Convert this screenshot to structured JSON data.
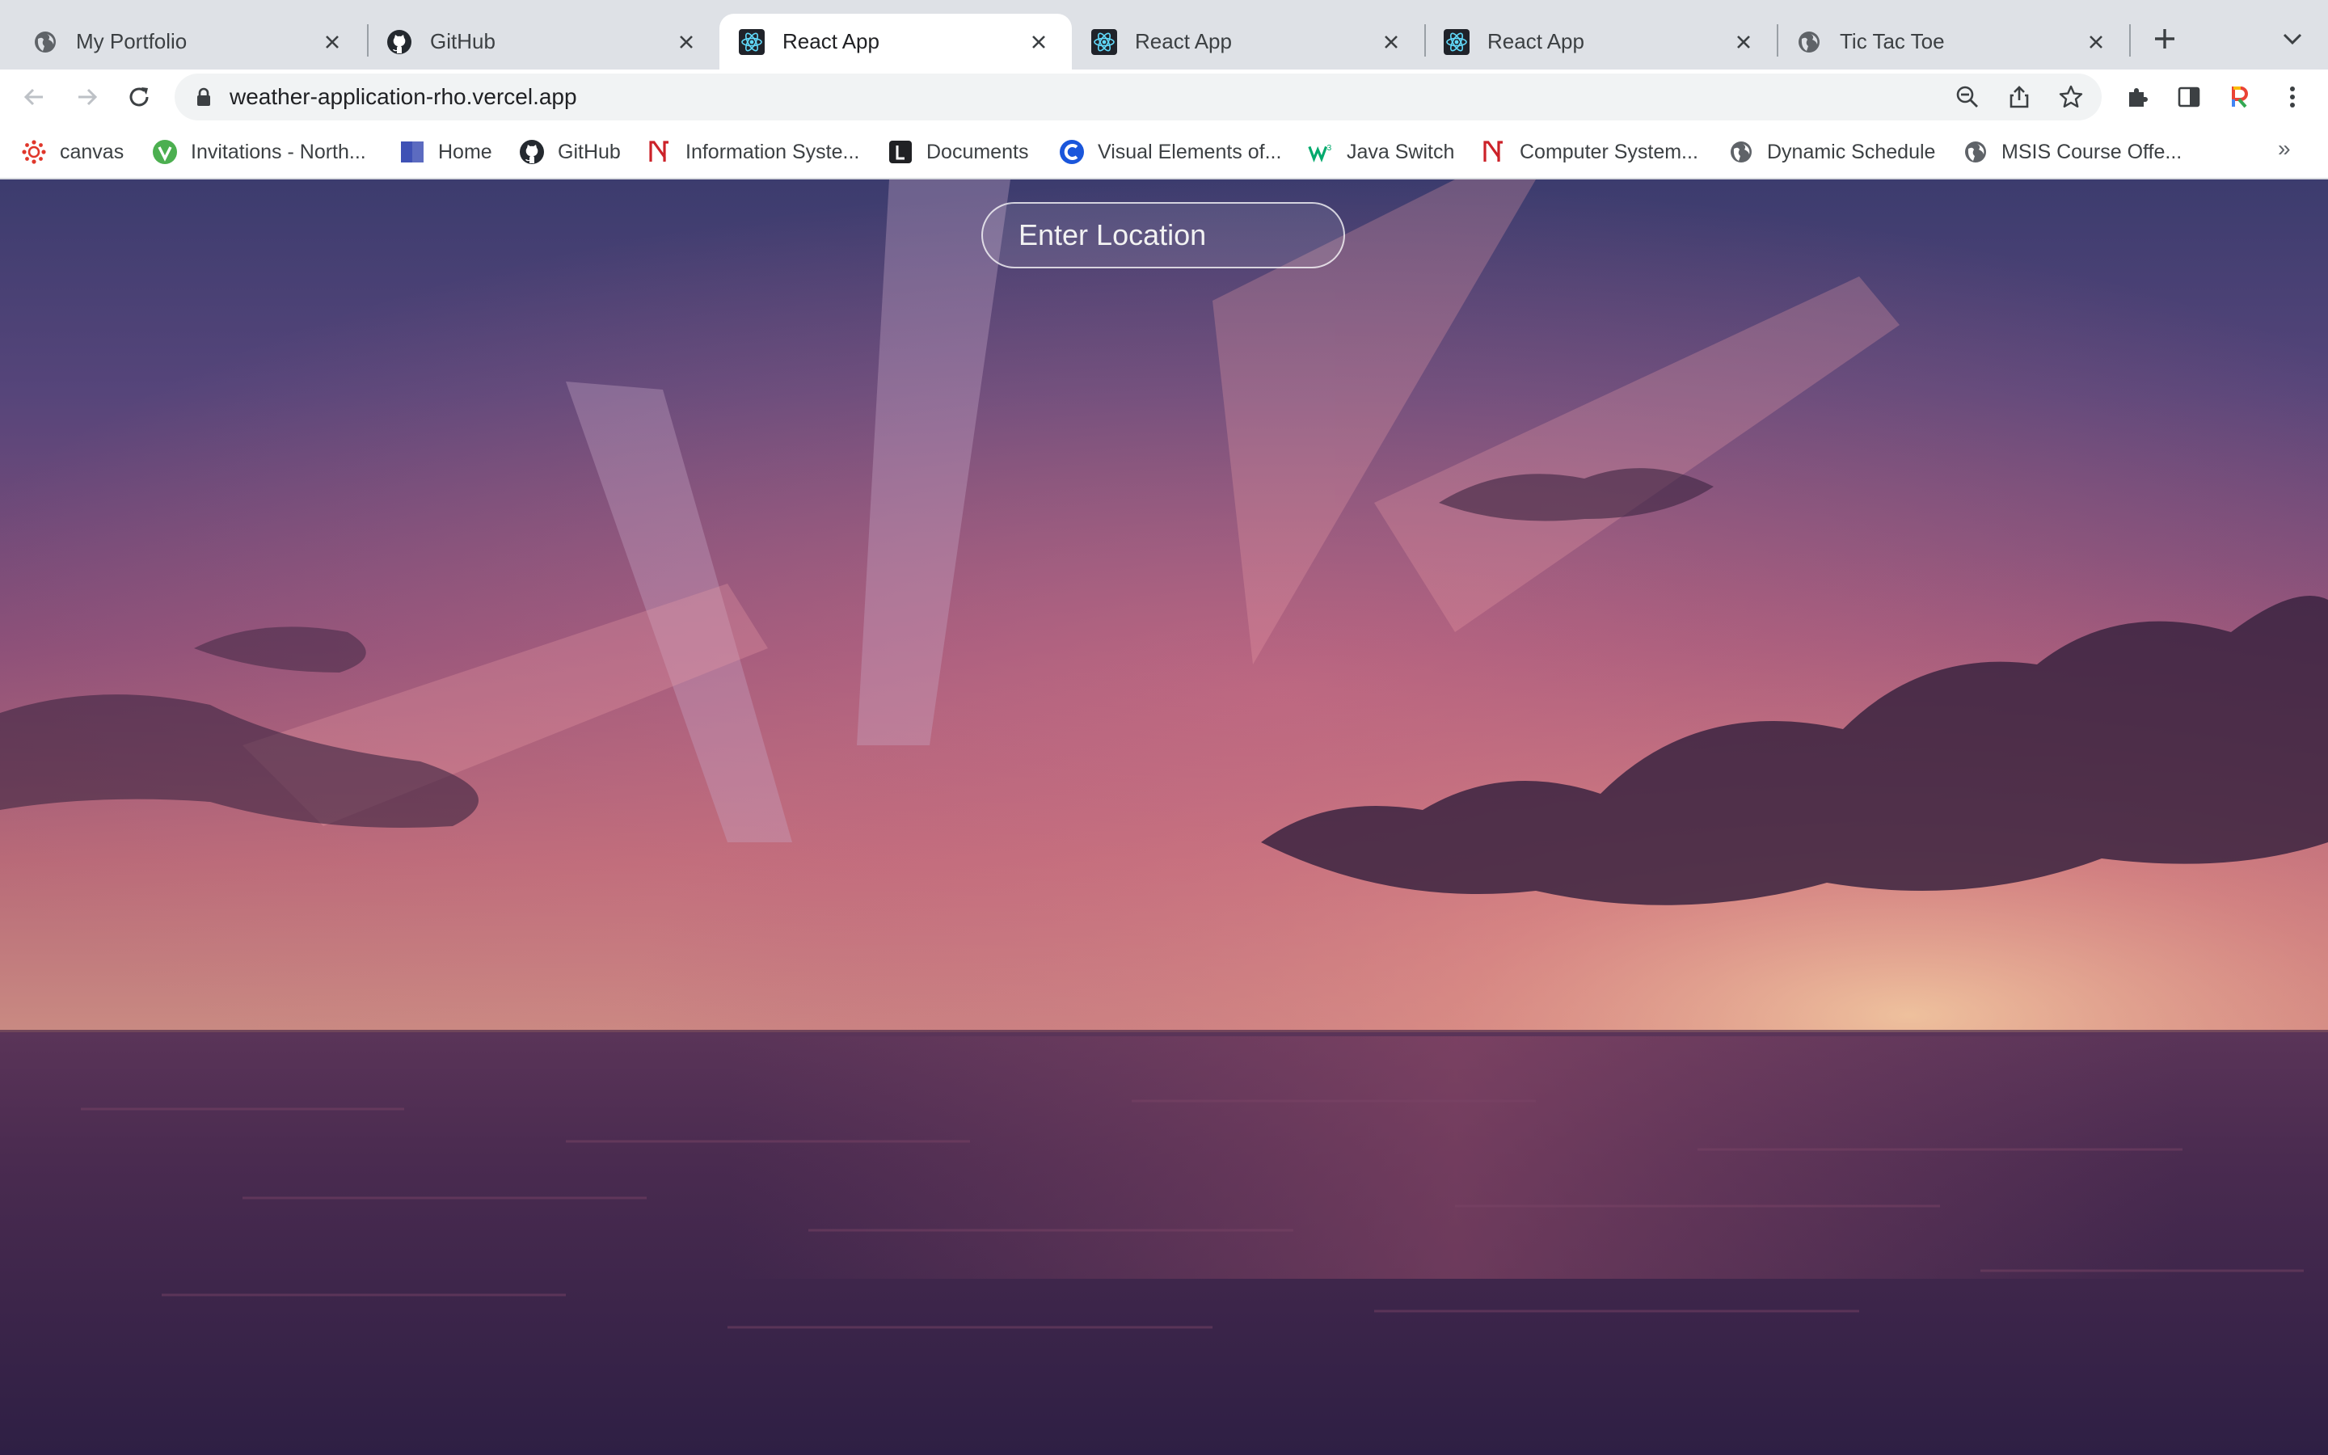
{
  "browser": {
    "tabs": [
      {
        "title": "My Portfolio",
        "favicon": "globe-icon",
        "active": false
      },
      {
        "title": "GitHub",
        "favicon": "github-icon",
        "active": false
      },
      {
        "title": "React App",
        "favicon": "react-icon",
        "active": true
      },
      {
        "title": "React App",
        "favicon": "react-icon",
        "active": false
      },
      {
        "title": "React App",
        "favicon": "react-icon",
        "active": false
      },
      {
        "title": "Tic Tac Toe",
        "favicon": "globe-icon",
        "active": false
      }
    ],
    "url": "weather-application-rho.vercel.app",
    "bookmarks": [
      {
        "label": "canvas",
        "icon": "canvas-icon"
      },
      {
        "label": "Invitations - North...",
        "icon": "invitations-icon"
      },
      {
        "label": "Home",
        "icon": "home-bookmark-icon"
      },
      {
        "label": "GitHub",
        "icon": "github-icon"
      },
      {
        "label": "Information Syste...",
        "icon": "northeastern-icon"
      },
      {
        "label": "Documents",
        "icon": "documents-icon"
      },
      {
        "label": "Visual Elements of...",
        "icon": "visual-elements-icon"
      },
      {
        "label": "Java Switch",
        "icon": "w3schools-icon"
      },
      {
        "label": "Computer System...",
        "icon": "northeastern-icon"
      },
      {
        "label": "Dynamic Schedule",
        "icon": "globe-icon"
      },
      {
        "label": "MSIS Course Offe...",
        "icon": "globe-icon"
      }
    ],
    "bookmarks_overflow": "»"
  },
  "app": {
    "search": {
      "placeholder": "Enter Location",
      "value": ""
    }
  },
  "colors": {
    "tab_strip": "#dee1e6",
    "toolbar": "#ffffff",
    "omnibox": "#f1f3f4",
    "react_blue": "#61dafb",
    "northeastern_red": "#cc2229"
  }
}
